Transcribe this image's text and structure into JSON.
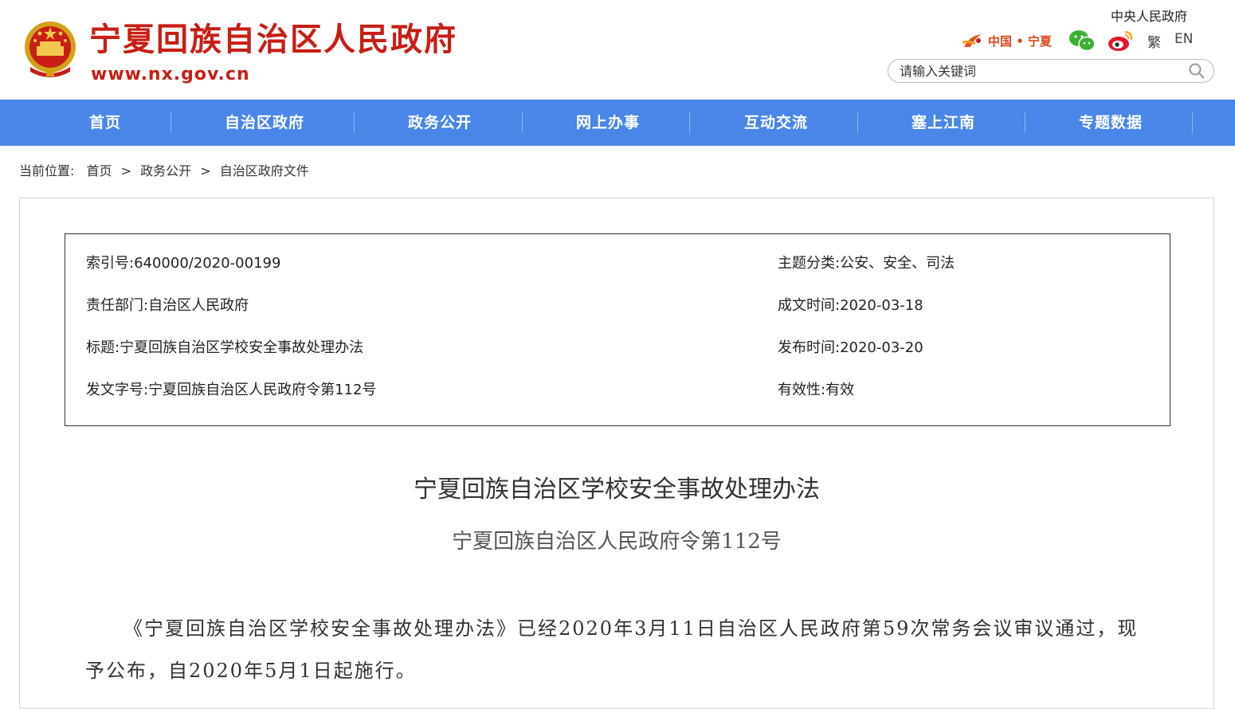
{
  "header": {
    "site_title": "宁夏回族自治区人民政府",
    "site_url": "www.nx.gov.cn",
    "central_gov_link": "中央人民政府",
    "china_ningxia_label": "中国 • 宁夏",
    "lang_traditional": "繁",
    "lang_english": "EN",
    "search_placeholder": "请输入关键词",
    "icons": [
      "national-emblem-icon",
      "china-ningxia-logo-icon",
      "wechat-icon",
      "weibo-icon",
      "search-icon"
    ]
  },
  "nav": {
    "items": [
      {
        "label": "首页"
      },
      {
        "label": "自治区政府"
      },
      {
        "label": "政务公开"
      },
      {
        "label": "网上办事"
      },
      {
        "label": "互动交流"
      },
      {
        "label": "塞上江南"
      },
      {
        "label": "专题数据"
      }
    ]
  },
  "breadcrumb": {
    "prefix": "当前位置:",
    "items": [
      "首页",
      "政务公开",
      "自治区政府文件"
    ],
    "separator": ">"
  },
  "meta": {
    "index_label": "索引号:",
    "index_value": "640000/2020-00199",
    "topic_label": "主题分类:",
    "topic_value": "公安、安全、司法",
    "dept_label": "责任部门:",
    "dept_value": "自治区人民政府",
    "created_label": "成文时间:",
    "created_value": "2020-03-18",
    "title_label": "标题:",
    "title_value": "宁夏回族自治区学校安全事故处理办法",
    "published_label": "发布时间:",
    "published_value": "2020-03-20",
    "docno_label": "发文字号:",
    "docno_value": "宁夏回族自治区人民政府令第112号",
    "validity_label": "有效性:",
    "validity_value": "有效"
  },
  "document": {
    "title": "宁夏回族自治区学校安全事故处理办法",
    "number": "宁夏回族自治区人民政府令第112号",
    "body": "《宁夏回族自治区学校安全事故处理办法》已经2020年3月11日自治区人民政府第59次常务会议审议通过，现予公布，自2020年5月1日起施行。"
  },
  "colors": {
    "brand_red": "#c81e14",
    "nav_blue": "#4a86e8"
  }
}
